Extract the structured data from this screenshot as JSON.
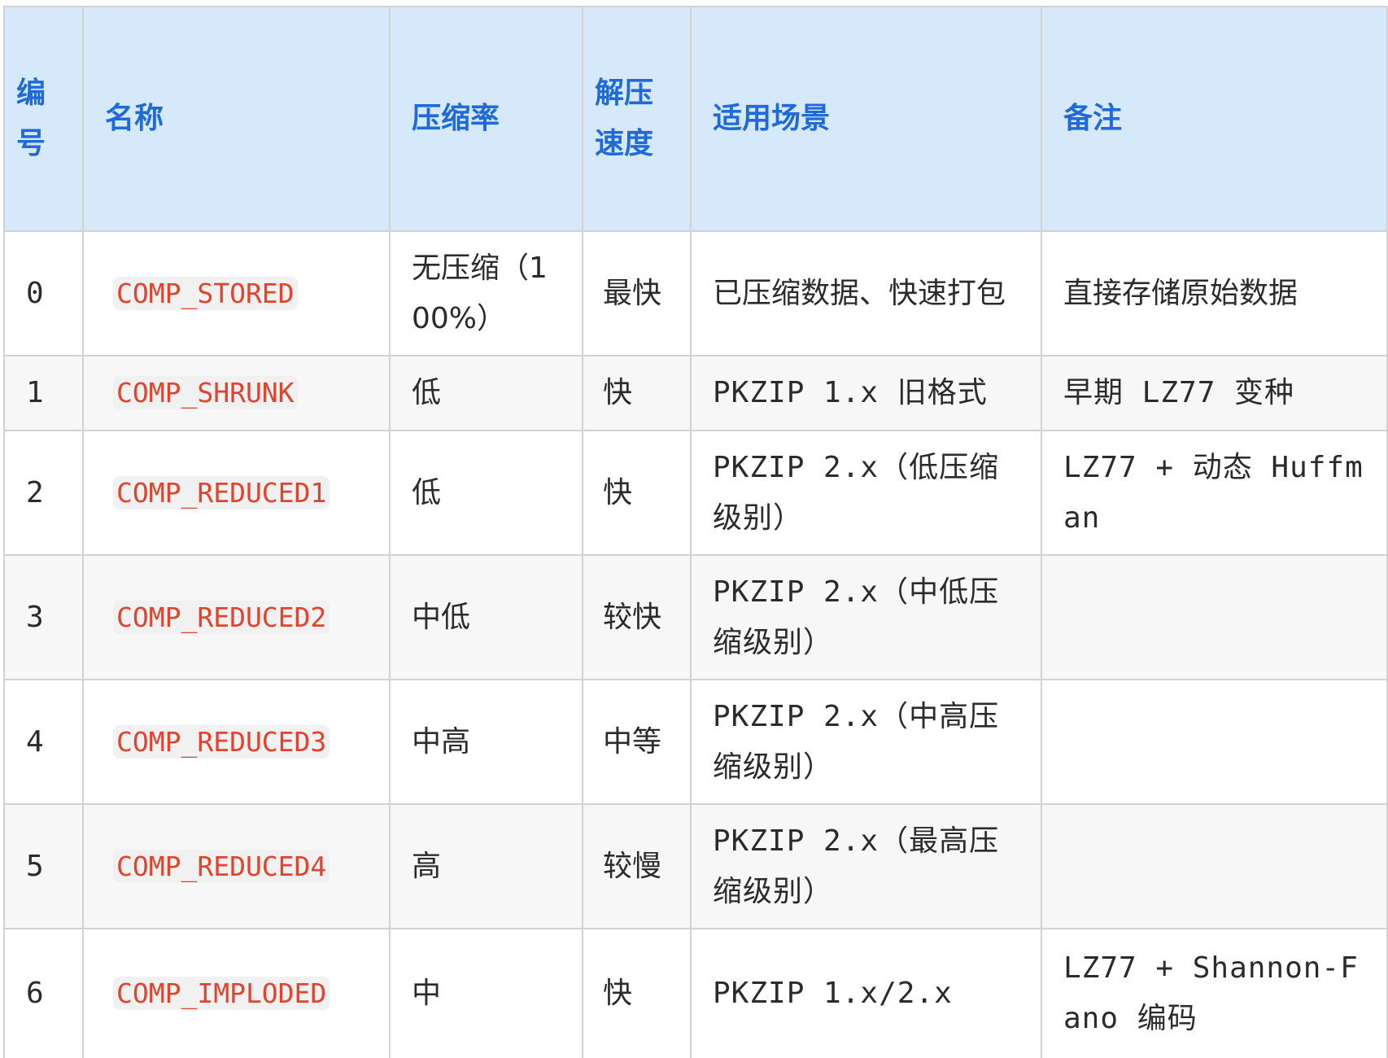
{
  "table": {
    "headers": {
      "id": "编号",
      "name": "名称",
      "ratio": "压缩率",
      "speed": "解压速度",
      "scenario": "适用场景",
      "note": "备注"
    },
    "rows": [
      {
        "id": "0",
        "name": "COMP_STORED",
        "ratio": "无压缩（100%）",
        "speed": "最快",
        "scenario": "已压缩数据、快速打包",
        "note": "直接存储原始数据"
      },
      {
        "id": "1",
        "name": "COMP_SHRUNK",
        "ratio": "低",
        "speed": "快",
        "scenario": "PKZIP 1.x 旧格式",
        "note": "早期 LZ77 变种"
      },
      {
        "id": "2",
        "name": "COMP_REDUCED1",
        "ratio": "低",
        "speed": "快",
        "scenario": "PKZIP 2.x（低压缩级别）",
        "note": "LZ77 + 动态 Huffman"
      },
      {
        "id": "3",
        "name": "COMP_REDUCED2",
        "ratio": "中低",
        "speed": "较快",
        "scenario": "PKZIP 2.x（中低压缩级别）",
        "note": ""
      },
      {
        "id": "4",
        "name": "COMP_REDUCED3",
        "ratio": "中高",
        "speed": "中等",
        "scenario": "PKZIP 2.x（中高压缩级别）",
        "note": ""
      },
      {
        "id": "5",
        "name": "COMP_REDUCED4",
        "ratio": "高",
        "speed": "较慢",
        "scenario": "PKZIP 2.x（最高压缩级别）",
        "note": ""
      },
      {
        "id": "6",
        "name": "COMP_IMPLODED",
        "ratio": "中",
        "speed": "快",
        "scenario": "PKZIP 1.x/2.x",
        "note": "LZ77 + Shannon-Fano 编码"
      }
    ]
  }
}
